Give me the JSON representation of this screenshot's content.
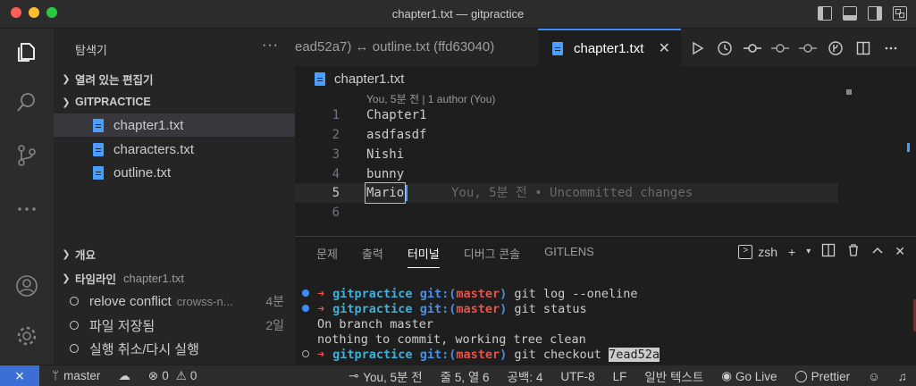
{
  "window": {
    "title": "chapter1.txt — gitpractice"
  },
  "sidebar": {
    "title": "탐색기",
    "more": "···",
    "open_editors": "열려 있는 편집기",
    "project": "GITPRACTICE",
    "files": [
      "chapter1.txt",
      "characters.txt",
      "outline.txt"
    ],
    "outline": "개요",
    "timeline": {
      "label": "타임라인",
      "file": "chapter1.txt",
      "items": [
        {
          "label": "relove conflict",
          "desc": "crowss-n...",
          "time": "4분"
        },
        {
          "label": "파일 저장됨",
          "desc": "",
          "time": "2일"
        },
        {
          "label": "실행 취소/다시 실행",
          "desc": "",
          "time": ""
        }
      ]
    }
  },
  "tabs": {
    "inactive": "ead52a7) ↔ outline.txt (ffd63040)",
    "active": "chapter1.txt",
    "close": "✕"
  },
  "editor": {
    "breadcrumb": "chapter1.txt",
    "codelens": "You, 5분 전 | 1 author (You)",
    "lines": [
      {
        "num": "1",
        "text": "Chapter1"
      },
      {
        "num": "2",
        "text": "asdfasdf"
      },
      {
        "num": "3",
        "text": "Nishi"
      },
      {
        "num": "4",
        "text": "bunny"
      },
      {
        "num": "5",
        "text": "Mario"
      },
      {
        "num": "6",
        "text": ""
      }
    ],
    "blame": "You, 5분 전 • Uncommitted changes"
  },
  "panel": {
    "tabs": [
      "문제",
      "출력",
      "터미널",
      "디버그 콘솔",
      "GITLENS"
    ],
    "active_tab": "터미널",
    "shell": "zsh",
    "terminal": {
      "prompt_dir": "gitpractice",
      "prompt_git": "git:(",
      "prompt_branch": "master",
      "prompt_close": ")",
      "cmd1": "git log --oneline",
      "cmd2": "git status",
      "out1": "On branch master",
      "out2": "nothing to commit, working tree clean",
      "cmd3": "git checkout ",
      "cmd3_sel": "7ead52a"
    }
  },
  "statusbar": {
    "branch": "master",
    "errors": "0",
    "warnings": "0",
    "blame": "You, 5분 전",
    "position": "줄 5, 열 6",
    "spaces": "공백: 4",
    "encoding": "UTF-8",
    "eol": "LF",
    "language": "일반 텍스트",
    "golive": "Go Live",
    "prettier": "Prettier"
  },
  "colors": {
    "accent": "#3c8cff",
    "remote": "#3c6fd6",
    "prompt_arrow": "#e5534b",
    "prompt_dir": "#3fb0d8"
  }
}
